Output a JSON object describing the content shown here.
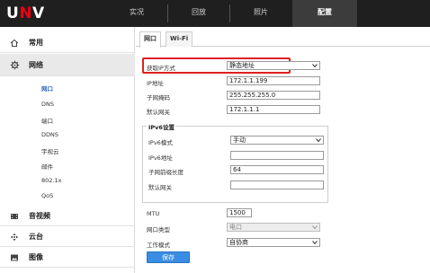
{
  "header": {
    "logo_text": "UNV",
    "nav": [
      {
        "label": "实况",
        "active": false
      },
      {
        "label": "回放",
        "active": false
      },
      {
        "label": "照片",
        "active": false
      },
      {
        "label": "配置",
        "active": true
      }
    ]
  },
  "sidebar": {
    "categories": [
      {
        "label": "常用",
        "icon": "home-icon"
      },
      {
        "label": "网络",
        "icon": "gear-icon",
        "active": true
      },
      {
        "label": "音视频",
        "icon": "film-icon"
      },
      {
        "label": "云台",
        "icon": "ptz-icon"
      },
      {
        "label": "图像",
        "icon": "image-icon"
      }
    ],
    "network_items": [
      {
        "label": "网口",
        "active": true
      },
      {
        "label": "DNS"
      },
      {
        "label": "端口"
      },
      {
        "label": "DDNS"
      },
      {
        "label": "宇视云"
      },
      {
        "label": "邮件"
      },
      {
        "label": "802.1x"
      },
      {
        "label": "QoS"
      }
    ]
  },
  "tabs": [
    {
      "label": "网口",
      "active": true
    },
    {
      "label": "Wi-Fi",
      "active": false
    }
  ],
  "ipv4": {
    "mode_label": "获取IP方式",
    "mode_value": "静态地址",
    "ip_label": "IP地址",
    "ip_value": "172.1.1.199",
    "mask_label": "子网掩码",
    "mask_value": "255.255.255.0",
    "gateway_label": "默认网关",
    "gateway_value": "172.1.1.1"
  },
  "ipv6": {
    "title": "IPv6设置",
    "mode_label": "IPv6模式",
    "mode_value": "手动",
    "addr_label": "IPv6地址",
    "addr_value": "",
    "prefix_label": "子网前缀长度",
    "prefix_value": "64",
    "gateway_label": "默认网关",
    "gateway_value": ""
  },
  "other": {
    "mtu_label": "MTU",
    "mtu_value": "1500",
    "porttype_label": "网口类型",
    "porttype_value": "电口",
    "workmode_label": "工作模式",
    "workmode_value": "自协商"
  },
  "save_label": "保存",
  "colors": {
    "topbar": "#1f1f1f",
    "highlight": "#e0201b",
    "button": "#3a8de3",
    "active_link": "#2a6ac7"
  }
}
